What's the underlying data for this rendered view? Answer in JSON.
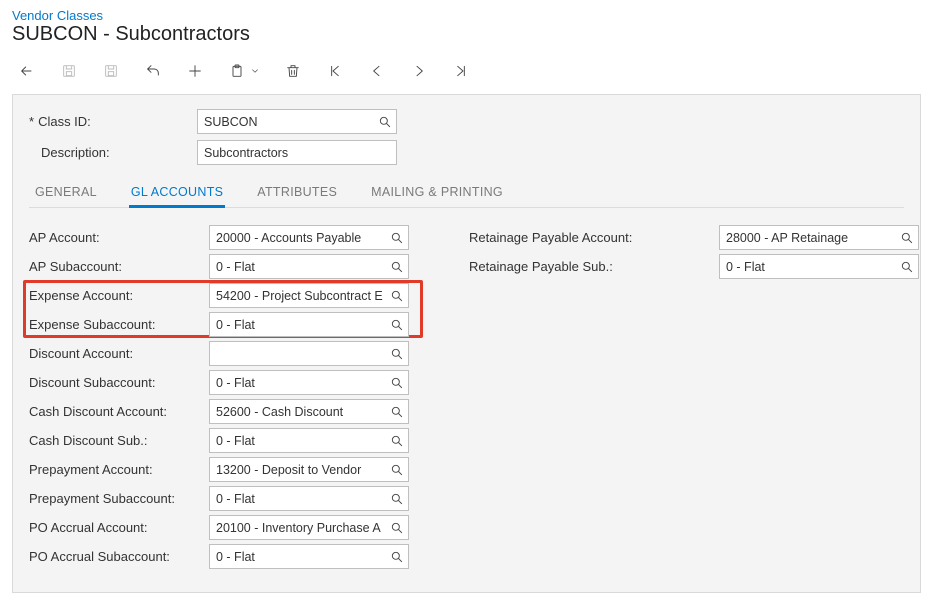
{
  "breadcrumb": "Vendor Classes",
  "title": "SUBCON - Subcontractors",
  "header": {
    "class_id_label": "Class ID:",
    "class_id_value": "SUBCON",
    "description_label": "Description:",
    "description_value": "Subcontractors"
  },
  "tabs": {
    "general": "GENERAL",
    "gl_accounts": "GL ACCOUNTS",
    "attributes": "ATTRIBUTES",
    "mailing": "MAILING & PRINTING"
  },
  "left_fields": [
    {
      "label": "AP Account:",
      "value": "20000 - Accounts Payable",
      "lookup": true
    },
    {
      "label": "AP Subaccount:",
      "value": "0 - Flat",
      "lookup": true
    },
    {
      "label": "Expense Account:",
      "value": "54200 - Project Subcontract E",
      "lookup": true
    },
    {
      "label": "Expense Subaccount:",
      "value": "0 - Flat",
      "lookup": true
    },
    {
      "label": "Discount Account:",
      "value": "",
      "lookup": true
    },
    {
      "label": "Discount Subaccount:",
      "value": "0 - Flat",
      "lookup": true
    },
    {
      "label": "Cash Discount Account:",
      "value": "52600 - Cash Discount",
      "lookup": true
    },
    {
      "label": "Cash Discount Sub.:",
      "value": "0 - Flat",
      "lookup": true
    },
    {
      "label": "Prepayment Account:",
      "value": "13200 - Deposit to Vendor",
      "lookup": true
    },
    {
      "label": "Prepayment Subaccount:",
      "value": "0 - Flat",
      "lookup": true
    },
    {
      "label": "PO Accrual Account:",
      "value": "20100 - Inventory Purchase A",
      "lookup": true
    },
    {
      "label": "PO Accrual Subaccount:",
      "value": "0 - Flat",
      "lookup": true
    }
  ],
  "right_fields": [
    {
      "label": "Retainage Payable Account:",
      "value": "28000 - AP Retainage",
      "lookup": true
    },
    {
      "label": "Retainage Payable Sub.:",
      "value": "0 - Flat",
      "lookup": true
    }
  ]
}
